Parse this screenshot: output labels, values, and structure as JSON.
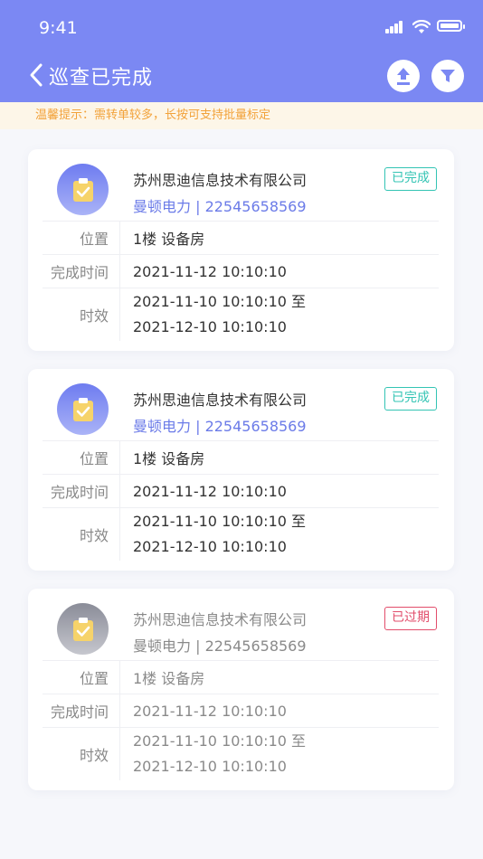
{
  "status_bar": {
    "time": "9:41"
  },
  "header": {
    "title": "巡查已完成"
  },
  "notice": "温馨提示：需转单较多，长按可支持批量标定",
  "labels": {
    "location": "位置",
    "complete_time": "完成时间",
    "validity": "时效"
  },
  "cards": [
    {
      "company": "苏州思迪信息技术有限公司",
      "contact": "曼顿电力 | 22545658569",
      "status": "已完成",
      "location": "1楼 设备房",
      "complete_time": "2021-11-12 10:10:10",
      "validity_start": "2021-11-10 10:10:10 至",
      "validity_end": "2021-12-10 10:10:10"
    },
    {
      "company": "苏州思迪信息技术有限公司",
      "contact": "曼顿电力 | 22545658569",
      "status": "已完成",
      "location": "1楼 设备房",
      "complete_time": "2021-11-12 10:10:10",
      "validity_start": "2021-11-10 10:10:10 至",
      "validity_end": "2021-12-10 10:10:10"
    },
    {
      "company": "苏州思迪信息技术有限公司",
      "contact": "曼顿电力 | 22545658569",
      "status": "已过期",
      "location": "1楼 设备房",
      "complete_time": "2021-11-12 10:10:10",
      "validity_start": "2021-11-10 10:10:10 至",
      "validity_end": "2021-12-10 10:10:10"
    }
  ],
  "colors": {
    "header": "#7b88f3",
    "accent": "#6b7be8",
    "done": "#33c4b4",
    "expired": "#e24d6b",
    "notice_text": "#f2a23a",
    "notice_bg": "#fdf6e8"
  },
  "icons": {
    "back": "chevron-left-icon",
    "upload": "upload-icon",
    "filter": "filter-icon",
    "task": "clipboard-check-icon"
  }
}
